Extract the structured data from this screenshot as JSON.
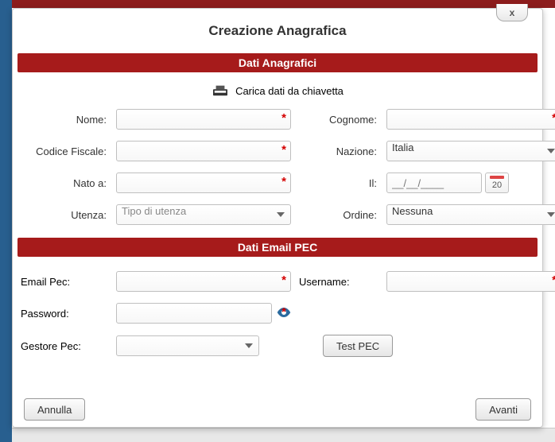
{
  "dialog": {
    "title": "Creazione Anagrafica",
    "close_label": "x"
  },
  "sections": {
    "anagrafici": "Dati Anagrafici",
    "pec": "Dati Email PEC"
  },
  "load_card": {
    "label": "Carica dati da chiavetta"
  },
  "labels": {
    "nome": "Nome:",
    "cognome": "Cognome:",
    "codice_fiscale": "Codice Fiscale:",
    "nazione": "Nazione:",
    "nato_a": "Nato a:",
    "il": "Il:",
    "utenza": "Utenza:",
    "ordine": "Ordine:",
    "email_pec": "Email Pec:",
    "username": "Username:",
    "password": "Password:",
    "gestore_pec": "Gestore Pec:"
  },
  "values": {
    "nome": "",
    "cognome": "",
    "codice_fiscale": "",
    "nazione": "Italia",
    "nato_a": "",
    "il_placeholder": "__/__/____",
    "cal_day": "20",
    "utenza": "Tipo di utenza",
    "ordine": "Nessuna",
    "email_pec": "",
    "username": "",
    "password": "",
    "gestore_pec": ""
  },
  "buttons": {
    "test_pec": "Test PEC",
    "annulla": "Annulla",
    "avanti": "Avanti"
  },
  "required_marker": "*"
}
